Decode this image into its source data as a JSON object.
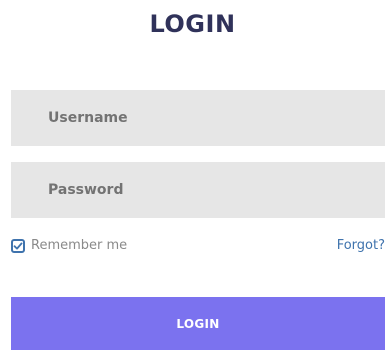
{
  "form": {
    "title": "LOGIN",
    "username_placeholder": "Username",
    "username_value": "",
    "password_placeholder": "Password",
    "password_value": "",
    "remember_label": "Remember me",
    "remember_checked": true,
    "forgot_label": "Forgot?",
    "submit_label": "LOGIN"
  },
  "icons": {
    "checkbox": "check-icon"
  },
  "colors": {
    "title": "#30325a",
    "field_bg": "#e6e6e6",
    "accent_blue": "#3f73ad",
    "button_bg": "#7b72ef",
    "button_text": "#ffffff"
  }
}
